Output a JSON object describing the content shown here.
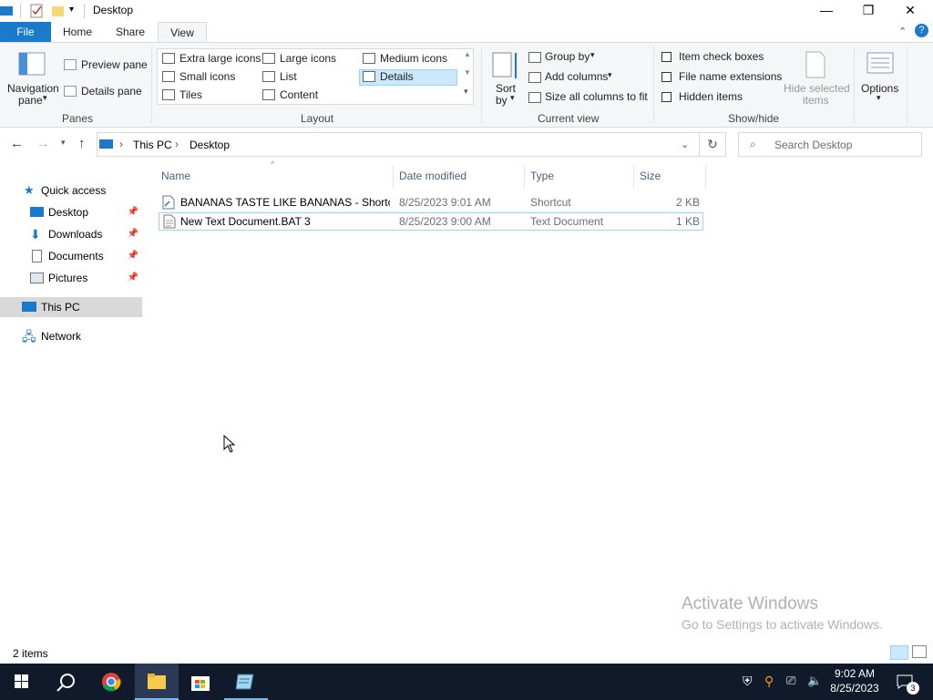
{
  "window": {
    "title": "Desktop"
  },
  "tabs": {
    "file": "File",
    "home": "Home",
    "share": "Share",
    "view": "View"
  },
  "ribbon": {
    "panes": {
      "navigation_pane": "Navigation",
      "navigation_pane_2": "pane",
      "preview_pane": "Preview pane",
      "details_pane": "Details pane",
      "label": "Panes"
    },
    "layout": {
      "extra_large_icons": "Extra large icons",
      "large_icons": "Large icons",
      "medium_icons": "Medium icons",
      "small_icons": "Small icons",
      "list": "List",
      "details": "Details",
      "tiles": "Tiles",
      "content": "Content",
      "label": "Layout"
    },
    "current_view": {
      "sort_by": "Sort",
      "sort_by_2": "by",
      "group_by": "Group by",
      "add_columns": "Add columns",
      "size_all_columns": "Size all columns to fit",
      "label": "Current view"
    },
    "show_hide": {
      "item_check_boxes": "Item check boxes",
      "file_name_extensions": "File name extensions",
      "hidden_items": "Hidden items",
      "hide_selected": "Hide selected",
      "hide_selected_2": "items",
      "label": "Show/hide"
    },
    "options": "Options"
  },
  "address": {
    "crumbs": [
      "This PC",
      "Desktop"
    ],
    "search_placeholder": "Search Desktop"
  },
  "nav": {
    "quick_access": "Quick access",
    "desktop": "Desktop",
    "downloads": "Downloads",
    "documents": "Documents",
    "pictures": "Pictures",
    "this_pc": "This PC",
    "network": "Network"
  },
  "columns": {
    "name": "Name",
    "date": "Date modified",
    "type": "Type",
    "size": "Size"
  },
  "files": [
    {
      "name": "BANANAS TASTE LIKE BANANAS - Shortc...",
      "date": "8/25/2023 9:01 AM",
      "type": "Shortcut",
      "size": "2 KB"
    },
    {
      "name": "New Text Document.BAT 3",
      "date": "8/25/2023 9:00 AM",
      "type": "Text Document",
      "size": "1 KB"
    }
  ],
  "status": {
    "count": "2 items"
  },
  "watermark": {
    "line1": "Activate Windows",
    "line2": "Go to Settings to activate Windows."
  },
  "taskbar": {
    "time": "9:02 AM",
    "date": "8/25/2023",
    "notifications": "3"
  },
  "colors": {
    "accent": "#1979ca",
    "selection": "#cce8ff",
    "taskbar": "#111a2b"
  }
}
